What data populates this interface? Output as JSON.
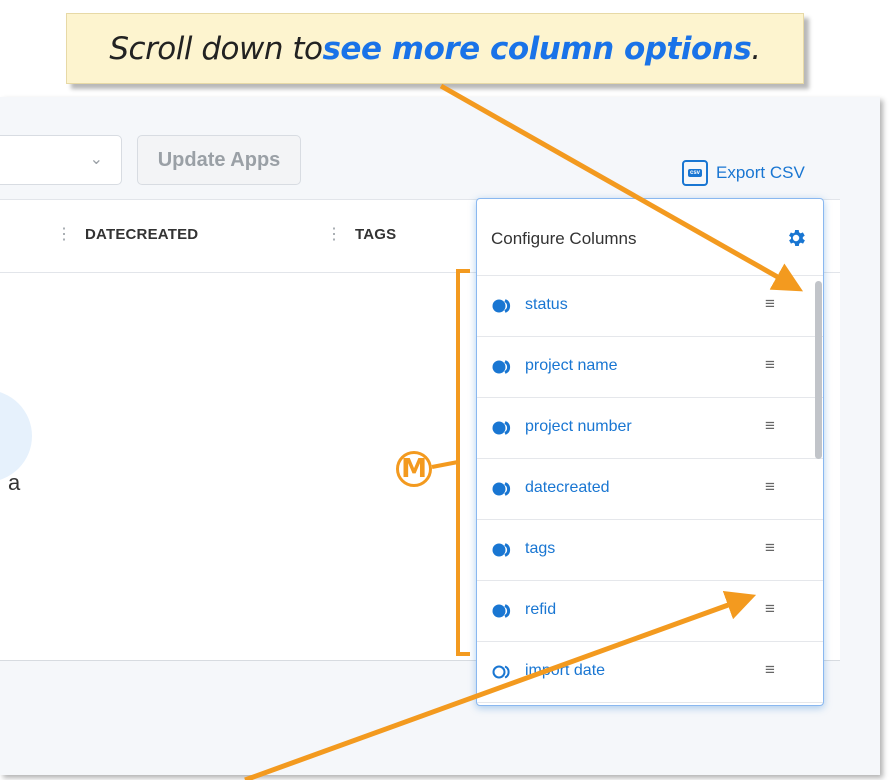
{
  "callout": {
    "text_before": "Scroll down to ",
    "highlight": "see more column options",
    "text_after": "."
  },
  "toolbar": {
    "update_apps_label": "Update Apps",
    "export_label": "Export CSV",
    "export_icon_text": "csv"
  },
  "table": {
    "columns": [
      {
        "label": "DATECREATED"
      },
      {
        "label": "TAGS"
      }
    ],
    "empty_text_fragment": "a"
  },
  "config": {
    "title": "Configure Columns",
    "items": [
      {
        "label": "status",
        "enabled": true
      },
      {
        "label": "project name",
        "enabled": true
      },
      {
        "label": "project number",
        "enabled": true
      },
      {
        "label": "datecreated",
        "enabled": true
      },
      {
        "label": "tags",
        "enabled": true
      },
      {
        "label": "refid",
        "enabled": true
      },
      {
        "label": "import date",
        "enabled": false
      }
    ]
  },
  "annotation": {
    "marker": "M",
    "accent_color": "#f39a1f"
  },
  "colors": {
    "primary": "#1976d2",
    "callout_bg": "#fdf4cf"
  }
}
